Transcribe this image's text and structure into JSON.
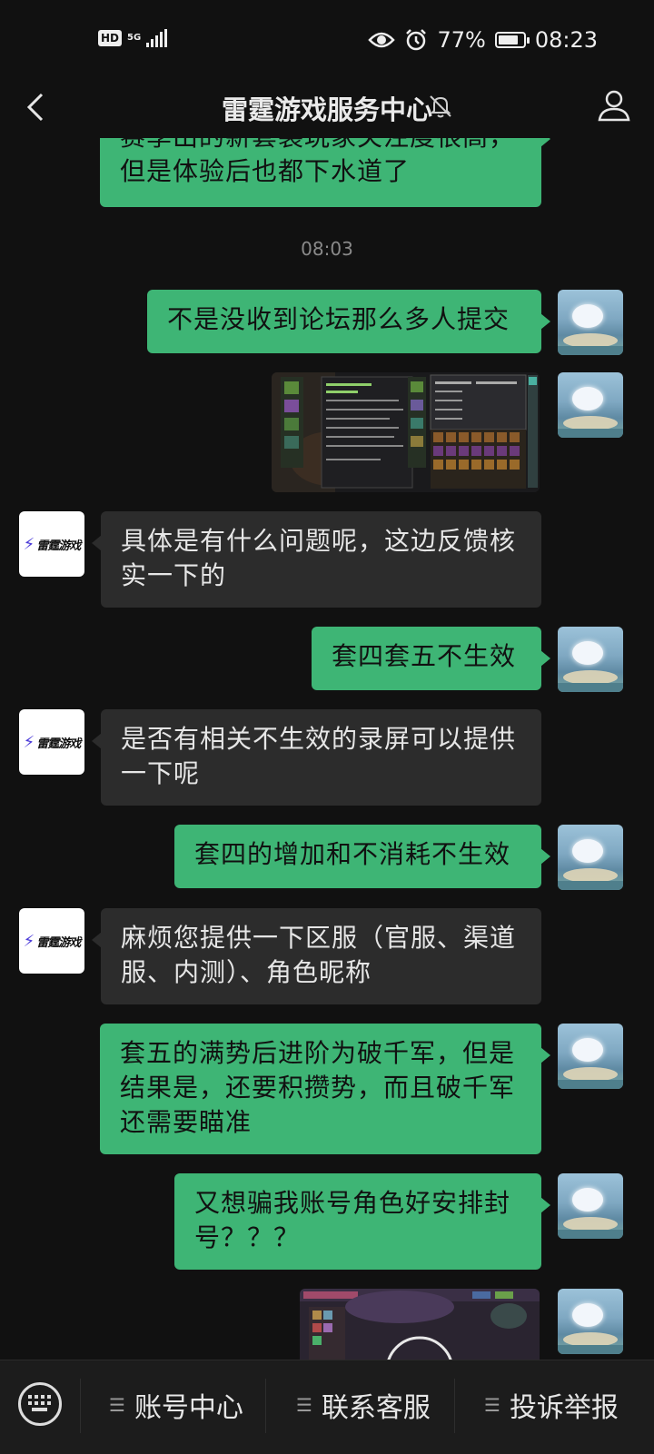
{
  "status_bar": {
    "hd": "HD",
    "network": "5G",
    "battery": "77%",
    "time": "08:23"
  },
  "header": {
    "title": "雷霆游戏服务中心"
  },
  "messages": {
    "m0": {
      "line1": "赛季出的新套装玩家关注度很高，",
      "line2": "但是体验后也都下水道了"
    },
    "timestamp": "08:03",
    "m1": "不是没收到论坛那么多人提交",
    "m3": {
      "line1": "具体是有什么问题呢，这边反馈核",
      "line2": "实一下的"
    },
    "m4": "套四套五不生效",
    "m5": {
      "line1": "是否有相关不生效的录屏可以提供",
      "line2": "一下呢"
    },
    "m6": "套四的增加和不消耗不生效",
    "m7": {
      "line1": "麻烦您提供一下区服（官服、渠道",
      "line2": "服、内测）、角色昵称"
    },
    "m8": {
      "line1": "套五的满势后进阶为破千军，但是",
      "line2": "结果是，还要积攒势，而且破千军",
      "line3": "还需要瞄准"
    },
    "m9": {
      "line1": "又想骗我账号角色好安排封",
      "line2": "号？？？"
    }
  },
  "bot_avatar": {
    "brand": "雷霆游戏"
  },
  "bottom_menu": {
    "item1": "账号中心",
    "item2": "联系客服",
    "item3": "投诉举报"
  }
}
